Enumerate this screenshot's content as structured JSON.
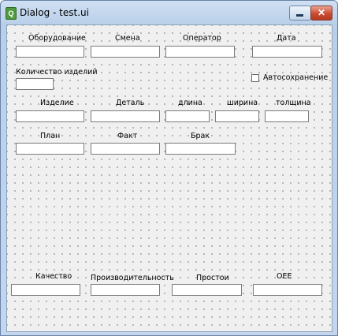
{
  "window": {
    "title": "Dialog - test.ui",
    "icon": "qt-designer-icon",
    "close_glyph": "✕"
  },
  "rows": {
    "row1": [
      "Оборудование",
      "Смена",
      "Оператор",
      "Дата"
    ],
    "quantity_label": "Количество изделий",
    "autosave_label": "Автосохранение",
    "autosave_checked": false,
    "row3": [
      "Изделие",
      "Деталь",
      "длина",
      "ширина",
      "толщина"
    ],
    "row4": [
      "План",
      "Факт",
      "Брак"
    ],
    "row5": [
      "Качество",
      "Производительность",
      "Простои",
      "OEE"
    ]
  },
  "fields": {
    "equipment": "",
    "shift": "",
    "operator": "",
    "date": "",
    "quantity": "",
    "product": "",
    "part": "",
    "length": "",
    "width": "",
    "thickness": "",
    "plan": "",
    "fact": "",
    "defect": "",
    "quality": "",
    "performance": "",
    "downtime": "",
    "oee": ""
  },
  "colors": {
    "titlebar": "#c3d6ee",
    "close_button": "#c94a31",
    "canvas": "#f0f0f0"
  }
}
